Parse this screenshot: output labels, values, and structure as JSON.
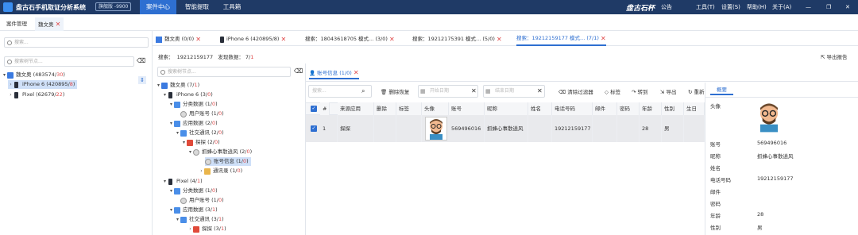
{
  "app": {
    "title": "盘古石手机取证分析系统",
    "version": "旗舰版 -9900",
    "brand": "盘古石杯"
  },
  "topmenu": [
    "案件中心",
    "智能提取",
    "工具箱"
  ],
  "topright": [
    "公告",
    "工具(T)",
    "设置(S)",
    "帮助(H)",
    "关于(A)"
  ],
  "tabs1": [
    {
      "label": "案件管理"
    },
    {
      "label": "魏文奥"
    }
  ],
  "left": {
    "search_placeholder": "搜索...",
    "filter_placeholder": "搜索树节点...",
    "case": {
      "label": "魏文奥",
      "count": "(483574/",
      "count_red": "30",
      "count_end": ")"
    },
    "dev1": {
      "label": "iPhone 6",
      "count": "(420895/",
      "count_red": "8",
      "count_end": ")"
    },
    "dev2": {
      "label": "Pixel",
      "count": "(62679/",
      "count_red": "22",
      "count_end": ")"
    }
  },
  "tabs2": [
    {
      "label": "魏文奥",
      "count": "(0/0)"
    },
    {
      "label": "iPhone 6",
      "count": "(420895/8)"
    },
    {
      "label": "搜索：18043618705 模式...",
      "count": "(3/0)"
    },
    {
      "label": "搜索：19212175391 模式...",
      "count": "(5/0)"
    },
    {
      "label": "搜索：19212159177 模式...",
      "count": "(7/1)"
    }
  ],
  "searchinfo": {
    "label": "搜索：",
    "value": "19212159177",
    "found_label": "发现数据：",
    "found": "7/",
    "found_red": "1",
    "export": "导出报告"
  },
  "mid": {
    "filter_placeholder": "搜索树节点...",
    "nodes": [
      {
        "label": "魏文奥",
        "count": "(7/",
        "red": "1",
        "end": ")"
      },
      {
        "label": "iPhone 6",
        "count": "(3/",
        "red": "0",
        "end": ")"
      },
      {
        "label": "分类数据",
        "count": "(1/",
        "red": "0",
        "end": ")"
      },
      {
        "label": "用户账号",
        "count": "(1/",
        "red": "0",
        "end": ")"
      },
      {
        "label": "应用数据",
        "count": "(2/",
        "red": "0",
        "end": ")"
      },
      {
        "label": "社交通讯",
        "count": "(2/",
        "red": "0",
        "end": ")"
      },
      {
        "label": "探探",
        "count": "(2/",
        "red": "0",
        "end": ")"
      },
      {
        "label": "抓蜂心事散逍风",
        "count": "(2/",
        "red": "0",
        "end": ")"
      },
      {
        "label": "账号信息",
        "count": "(1/",
        "red": "0",
        "end": ")"
      },
      {
        "label": "通讯录",
        "count": "(1/",
        "red": "0",
        "end": ")"
      },
      {
        "label": "Pixel",
        "count": "(4/",
        "red": "1",
        "end": ")"
      },
      {
        "label": "分类数据",
        "count": "(1/",
        "red": "0",
        "end": ")"
      },
      {
        "label": "用户账号",
        "count": "(1/",
        "red": "0",
        "end": ")"
      },
      {
        "label": "应用数据",
        "count": "(3/",
        "red": "1",
        "end": ")"
      },
      {
        "label": "社交通讯",
        "count": "(3/",
        "red": "1",
        "end": ")"
      },
      {
        "label": "探探",
        "count": "(3/",
        "red": "1",
        "end": ")"
      }
    ]
  },
  "content": {
    "tab": "账号信息",
    "tab_count": "(1/0)",
    "search_placeholder": "搜索...",
    "toolbar": {
      "delete_restore": "删除恢复",
      "start_date": "开始日期",
      "end_date": "结束日期",
      "clear_filter": "清除过滤器",
      "tag": "标签",
      "goto": "转到",
      "export": "导出",
      "refresh": "重新"
    },
    "columns": [
      "#",
      "来源应用",
      "删除",
      "标签",
      "头像",
      "账号",
      "昵称",
      "姓名",
      "电话号码",
      "邮件",
      "密码",
      "年龄",
      "性别",
      "生日"
    ],
    "row": {
      "index": "1",
      "app": "探探",
      "account": "569496016",
      "nickname": "抓蜂心事散逍风",
      "phone": "19212159177",
      "age": "28",
      "gender": "男"
    }
  },
  "detail": {
    "tab": "概要",
    "fields": [
      {
        "k": "头像",
        "v": ""
      },
      {
        "k": "账号",
        "v": "569496016"
      },
      {
        "k": "昵称",
        "v": "抓蜂心事散逍风"
      },
      {
        "k": "姓名",
        "v": ""
      },
      {
        "k": "电话号码",
        "v": "19212159177"
      },
      {
        "k": "邮件",
        "v": ""
      },
      {
        "k": "密码",
        "v": ""
      },
      {
        "k": "年龄",
        "v": "28"
      },
      {
        "k": "性别",
        "v": "男"
      }
    ]
  }
}
